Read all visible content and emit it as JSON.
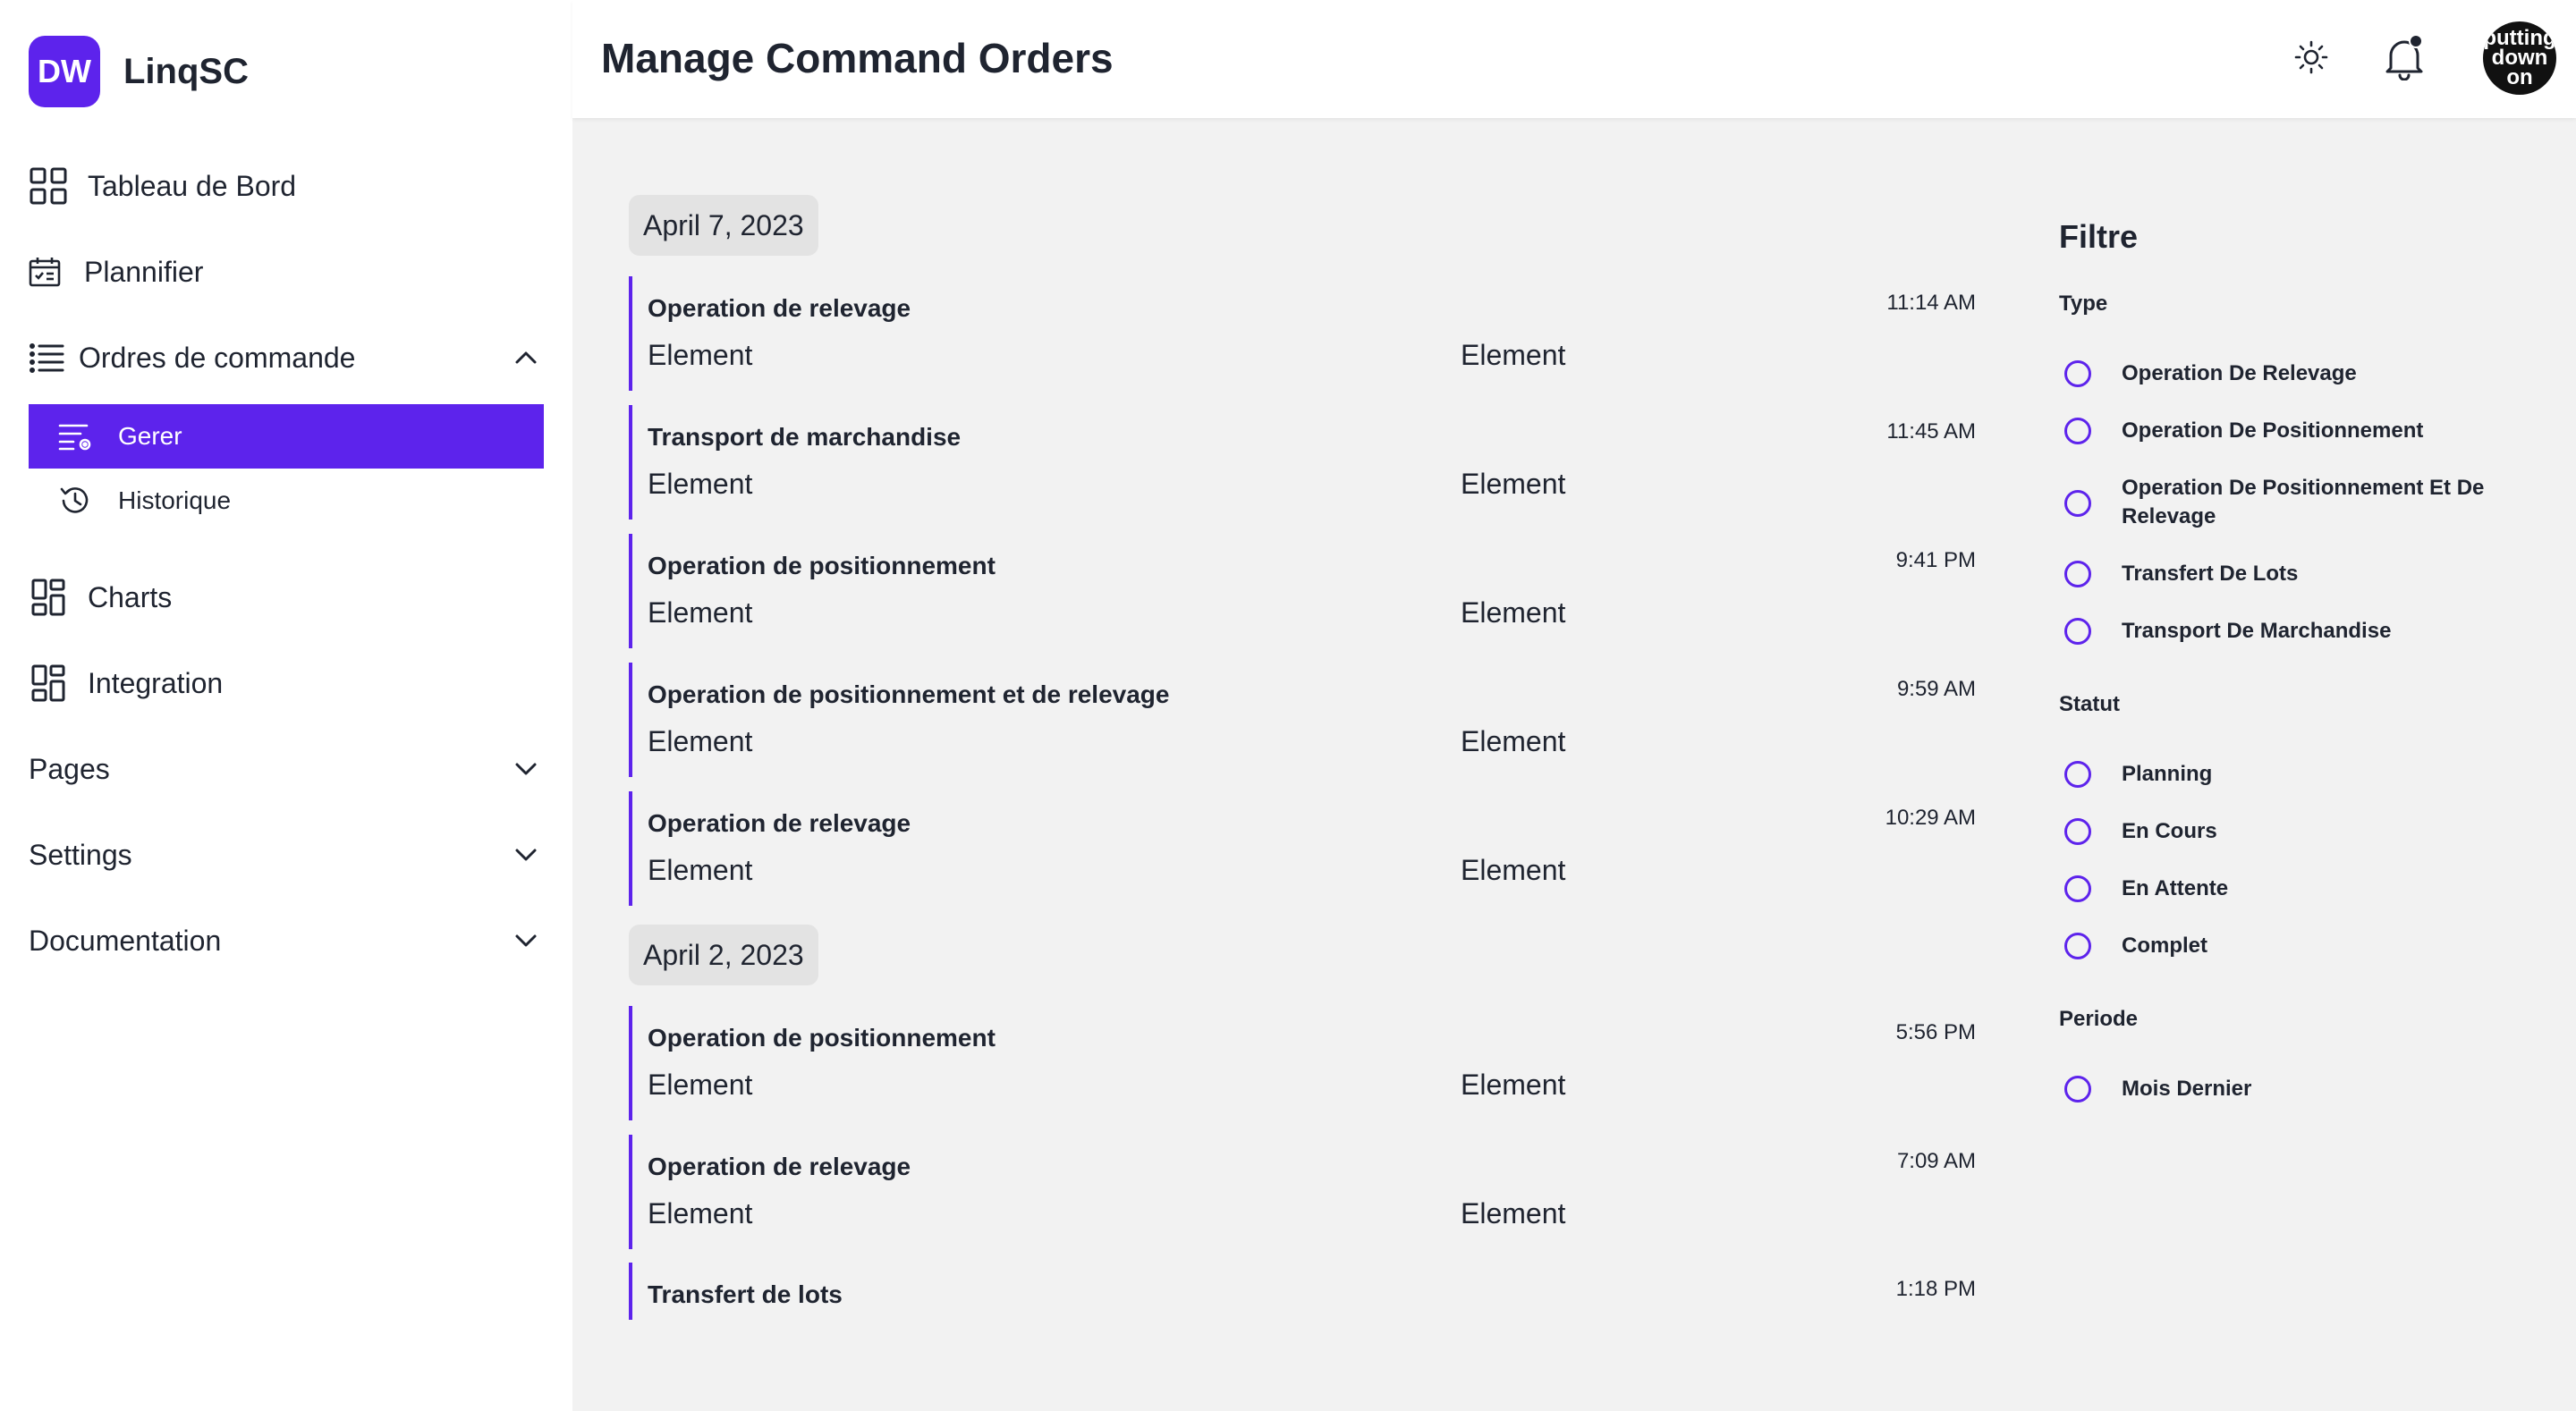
{
  "brand": {
    "logo_text": "DW",
    "name": "LinqSC"
  },
  "sidebar": {
    "items": [
      {
        "label": "Tableau de Bord",
        "icon": "grid-icon"
      },
      {
        "label": "Plannifier",
        "icon": "calendar-icon"
      },
      {
        "label": "Ordres de commande",
        "icon": "list-icon",
        "expanded": true
      },
      {
        "label": "Charts",
        "icon": "dashboard-icon"
      },
      {
        "label": "Integration",
        "icon": "dashboard-icon"
      },
      {
        "label": "Pages",
        "expandable": true
      },
      {
        "label": "Settings",
        "expandable": true
      },
      {
        "label": "Documentation",
        "expandable": true
      }
    ],
    "subitems": [
      {
        "label": "Gerer",
        "icon": "list-settings-icon",
        "active": true
      },
      {
        "label": "Historique",
        "icon": "history-icon",
        "active": false
      }
    ]
  },
  "header": {
    "title": "Manage Command Orders",
    "avatar_lines": [
      "putting",
      "down",
      "on"
    ]
  },
  "timeline": [
    {
      "date": "April 7, 2023",
      "orders": [
        {
          "title": "Operation de relevage",
          "time": "11:14 AM",
          "element1": "Element",
          "element2": "Element"
        },
        {
          "title": "Transport de marchandise",
          "time": "11:45 AM",
          "element1": "Element",
          "element2": "Element"
        },
        {
          "title": "Operation de positionnement",
          "time": "9:41 PM",
          "element1": "Element",
          "element2": "Element"
        },
        {
          "title": "Operation de positionnement et de relevage",
          "time": "9:59 AM",
          "element1": "Element",
          "element2": "Element"
        },
        {
          "title": "Operation de relevage",
          "time": "10:29 AM",
          "element1": "Element",
          "element2": "Element"
        }
      ]
    },
    {
      "date": "April 2, 2023",
      "orders": [
        {
          "title": "Operation de positionnement",
          "time": "5:56 PM",
          "element1": "Element",
          "element2": "Element"
        },
        {
          "title": "Operation de relevage",
          "time": "7:09 AM",
          "element1": "Element",
          "element2": "Element"
        },
        {
          "title": "Transfert de lots",
          "time": "1:18 PM"
        }
      ]
    }
  ],
  "filter": {
    "title": "Filtre",
    "sections": [
      {
        "label": "Type",
        "options": [
          "Operation De Relevage",
          "Operation De Positionnement",
          "Operation De Positionnement Et De Relevage",
          "Transfert De Lots",
          "Transport De Marchandise"
        ]
      },
      {
        "label": "Statut",
        "options": [
          "Planning",
          "En Cours",
          "En Attente",
          "Complet"
        ]
      },
      {
        "label": "Periode",
        "options": [
          "Mois Dernier"
        ]
      }
    ]
  },
  "colors": {
    "accent": "#5d23ec",
    "background": "#f2f2f2",
    "surface": "#ffffff",
    "date_badge": "#e3e3e3",
    "text": "#1f2430"
  }
}
